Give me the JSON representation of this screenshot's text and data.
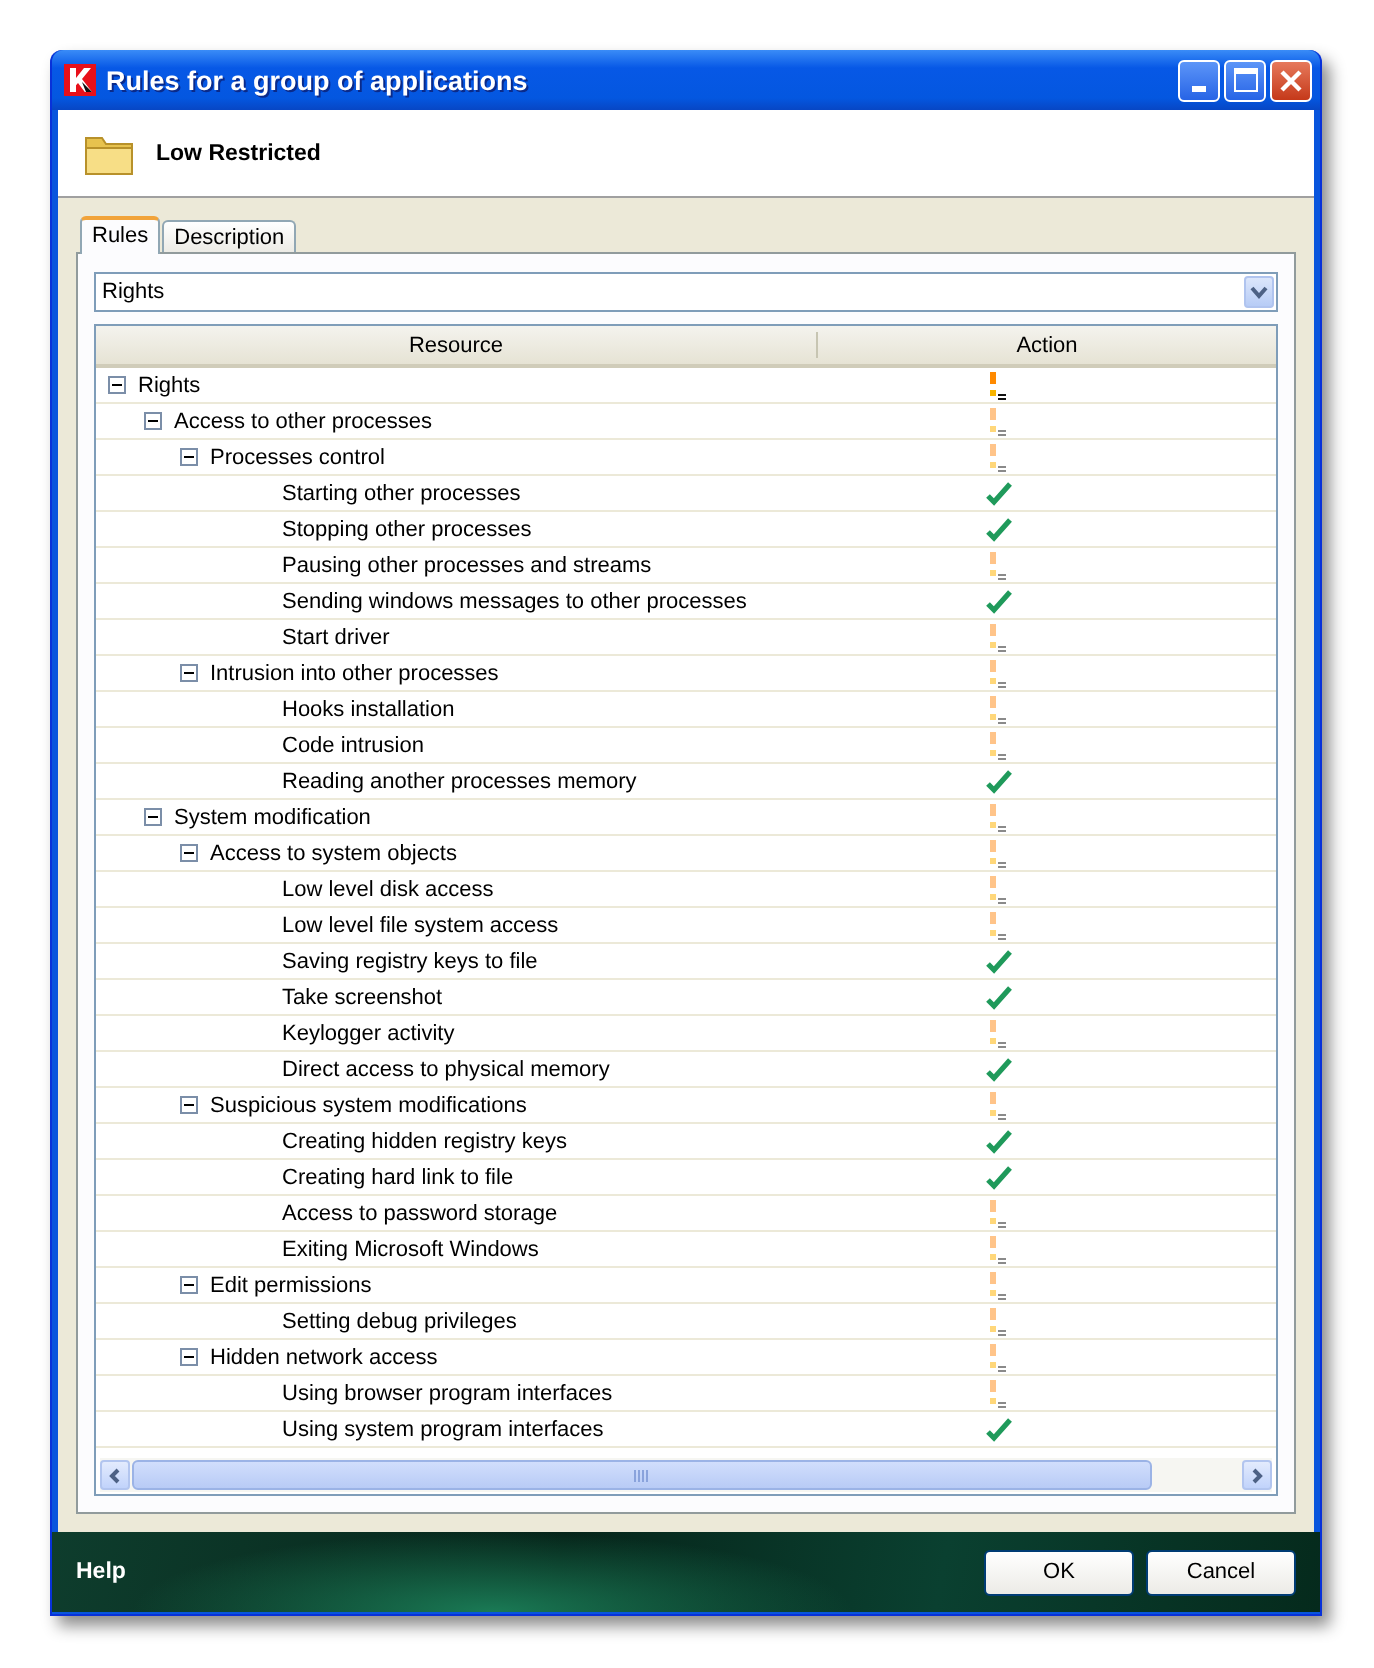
{
  "window": {
    "title": "Rules for a group of applications"
  },
  "header": {
    "group_name": "Low Restricted"
  },
  "tabs": [
    {
      "label": "Rules",
      "selected": true
    },
    {
      "label": "Description",
      "selected": false
    }
  ],
  "category_select": {
    "value": "Rights"
  },
  "table": {
    "columns": [
      "Resource",
      "Action"
    ],
    "rows": [
      {
        "name": "Rights",
        "kind": "ask_strong",
        "expanded": true,
        "children": [
          {
            "name": "Access to other processes",
            "kind": "ask",
            "expanded": true,
            "children": [
              {
                "name": "Processes control",
                "kind": "ask",
                "expanded": true,
                "children": [
                  {
                    "name": "Starting other processes",
                    "kind": "allow"
                  },
                  {
                    "name": "Stopping other processes",
                    "kind": "allow"
                  },
                  {
                    "name": "Pausing other processes and streams",
                    "kind": "ask"
                  },
                  {
                    "name": "Sending windows messages to other processes",
                    "kind": "allow"
                  },
                  {
                    "name": "Start driver",
                    "kind": "ask"
                  }
                ]
              },
              {
                "name": "Intrusion into other processes",
                "kind": "ask",
                "expanded": true,
                "children": [
                  {
                    "name": "Hooks installation",
                    "kind": "ask"
                  },
                  {
                    "name": "Code intrusion",
                    "kind": "ask"
                  },
                  {
                    "name": "Reading another processes memory",
                    "kind": "allow"
                  }
                ]
              }
            ]
          },
          {
            "name": "System modification",
            "kind": "ask",
            "expanded": true,
            "children": [
              {
                "name": "Access to system objects",
                "kind": "ask",
                "expanded": true,
                "children": [
                  {
                    "name": "Low level disk access",
                    "kind": "ask"
                  },
                  {
                    "name": "Low level file system access",
                    "kind": "ask"
                  },
                  {
                    "name": "Saving registry keys to file",
                    "kind": "allow"
                  },
                  {
                    "name": "Take screenshot",
                    "kind": "allow"
                  },
                  {
                    "name": "Keylogger activity",
                    "kind": "ask"
                  },
                  {
                    "name": "Direct access to physical memory",
                    "kind": "allow"
                  }
                ]
              },
              {
                "name": "Suspicious system modifications",
                "kind": "ask",
                "expanded": true,
                "children": [
                  {
                    "name": "Creating hidden registry keys",
                    "kind": "allow"
                  },
                  {
                    "name": "Creating hard link to file",
                    "kind": "allow"
                  },
                  {
                    "name": "Access to password storage",
                    "kind": "ask"
                  },
                  {
                    "name": "Exiting Microsoft Windows",
                    "kind": "ask"
                  }
                ]
              },
              {
                "name": "Edit permissions",
                "kind": "ask",
                "expanded": true,
                "children": [
                  {
                    "name": "Setting debug privileges",
                    "kind": "ask"
                  }
                ]
              },
              {
                "name": "Hidden network access",
                "kind": "ask",
                "expanded": true,
                "children": [
                  {
                    "name": "Using browser program interfaces",
                    "kind": "ask"
                  },
                  {
                    "name": "Using system program interfaces",
                    "kind": "allow"
                  }
                ]
              }
            ]
          }
        ]
      }
    ]
  },
  "footer": {
    "help": "Help",
    "buttons": [
      "OK",
      "Cancel"
    ]
  }
}
